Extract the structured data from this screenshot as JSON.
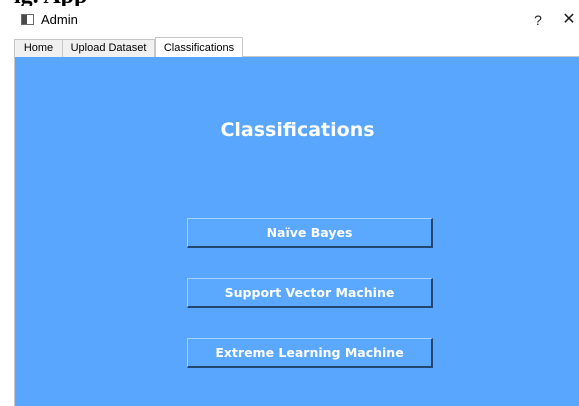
{
  "top_clipped_text": "ig. App",
  "window": {
    "title": "Admin",
    "help_label": "?",
    "close_label": "✕",
    "icon": "window-app-icon"
  },
  "tabs": [
    {
      "label": "Home",
      "active": false
    },
    {
      "label": "Upload Dataset",
      "active": false
    },
    {
      "label": "Classifications",
      "active": true
    }
  ],
  "panel": {
    "background": "#58a6fe",
    "title": "Classifications",
    "buttons": [
      {
        "label": "Naïve Bayes"
      },
      {
        "label": "Support Vector Machine"
      },
      {
        "label": "Extreme Learning Machine"
      }
    ]
  }
}
